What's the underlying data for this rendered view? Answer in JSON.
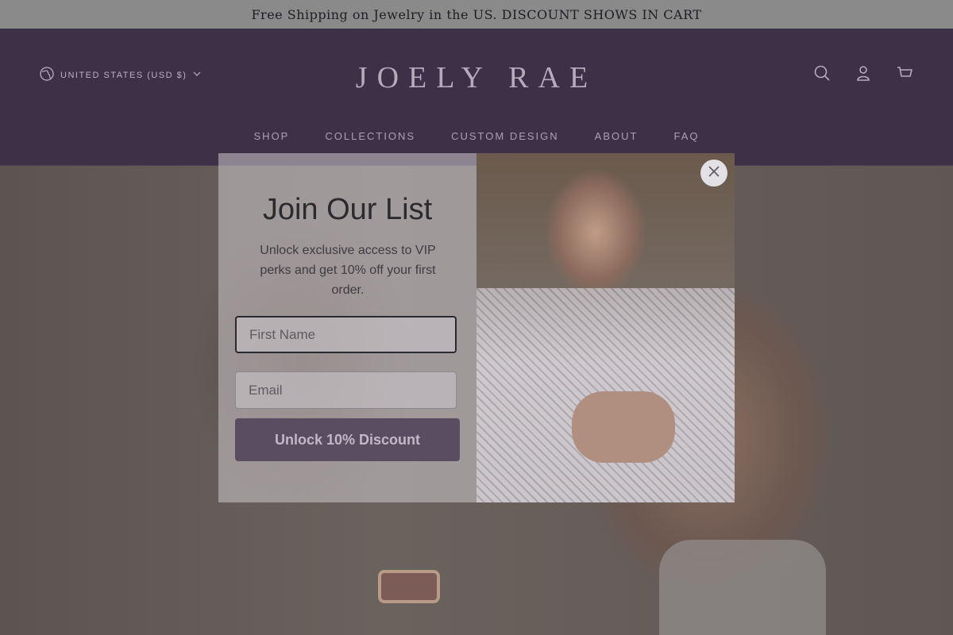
{
  "announcement": "Free Shipping on Jewelry in the US. DISCOUNT SHOWS IN CART",
  "header": {
    "country_selector": "UNITED STATES (USD $)",
    "logo": "JOELY RAE",
    "nav": [
      "SHOP",
      "COLLECTIONS",
      "CUSTOM DESIGN",
      "ABOUT",
      "FAQ"
    ],
    "icons": [
      "search-icon",
      "account-icon",
      "cart-icon"
    ]
  },
  "popup": {
    "title": "Join Our List",
    "subtitle": "Unlock exclusive access to VIP perks and get 10% off your first order.",
    "first_name_placeholder": "First Name",
    "email_placeholder": "Email",
    "submit_label": "Unlock 10% Discount"
  },
  "colors": {
    "header_bg": "#3c3147",
    "button_bg": "#5a4d62"
  }
}
